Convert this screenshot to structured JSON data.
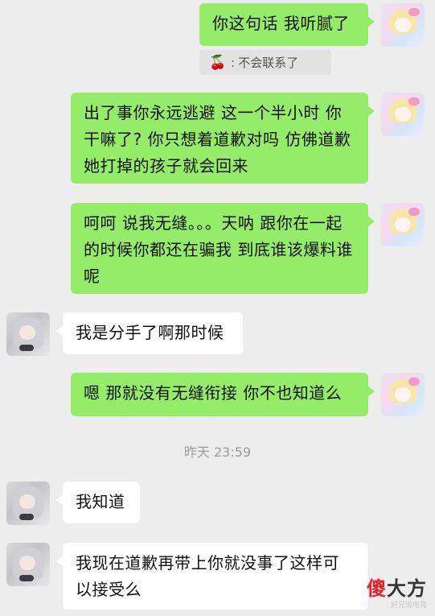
{
  "messages": [
    {
      "id": "m1",
      "text": "你这句话 我听腻了"
    },
    {
      "id": "m2",
      "text": "出了事你永远逃避 这一个半小时 你干嘛了? 你只想着道歉对吗 仿佛道歉 她打掉的孩子就会回来"
    },
    {
      "id": "m3",
      "text": "呵呵 说我无缝。。。天呐 跟你在一起的时候你都还在骗我 到底谁该爆料谁呢"
    },
    {
      "id": "m4",
      "text": "我是分手了啊那时候"
    },
    {
      "id": "m5",
      "text": "嗯 那就没有无缝衔接 你不也知道么"
    },
    {
      "id": "m6",
      "text": "我知道"
    },
    {
      "id": "m7",
      "text": "我现在道歉再带上你就没事了这样可以接受么"
    }
  ],
  "quote": {
    "icon": "cherry-icon",
    "separator": ":",
    "text": "不会联系了"
  },
  "timestamp": "昨天 23:59",
  "watermark": {
    "brand_part1": "傻",
    "brand_part2": "大方",
    "sub": "好兄说电竞"
  }
}
